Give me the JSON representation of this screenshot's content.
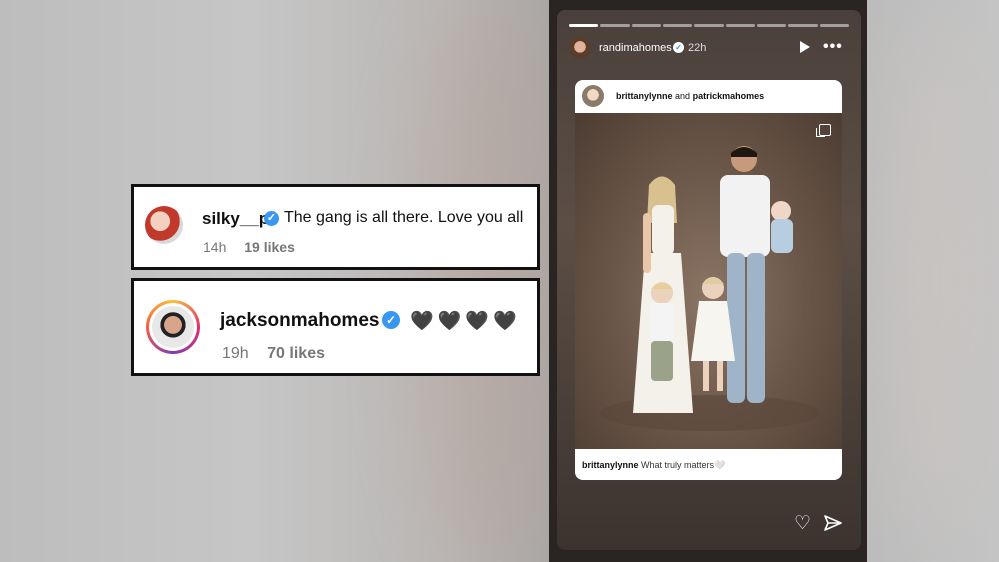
{
  "comments": [
    {
      "username": "silky__p",
      "text": "The gang is all there. Love you all",
      "time": "14h",
      "likes": "19 likes"
    },
    {
      "username": "jacksonmahomes",
      "text": "🖤🖤🖤🖤",
      "time": "19h",
      "likes": "70 likes"
    }
  ],
  "story": {
    "username": "randimahomes",
    "time": "22h",
    "post": {
      "author1": "brittanylynne",
      "and": "and",
      "author2": "patrickmahomes",
      "caption_user": "brittanylynne",
      "caption_text": "What truly matters🤍"
    }
  },
  "colors": {
    "verified": "#3897f0",
    "story_bg": "#4a403b"
  },
  "icons": {
    "verified": "verified-badge-icon",
    "play": "play-icon",
    "more": "more-icon",
    "heart": "heart-icon",
    "send": "send-icon",
    "multi": "carousel-icon"
  }
}
